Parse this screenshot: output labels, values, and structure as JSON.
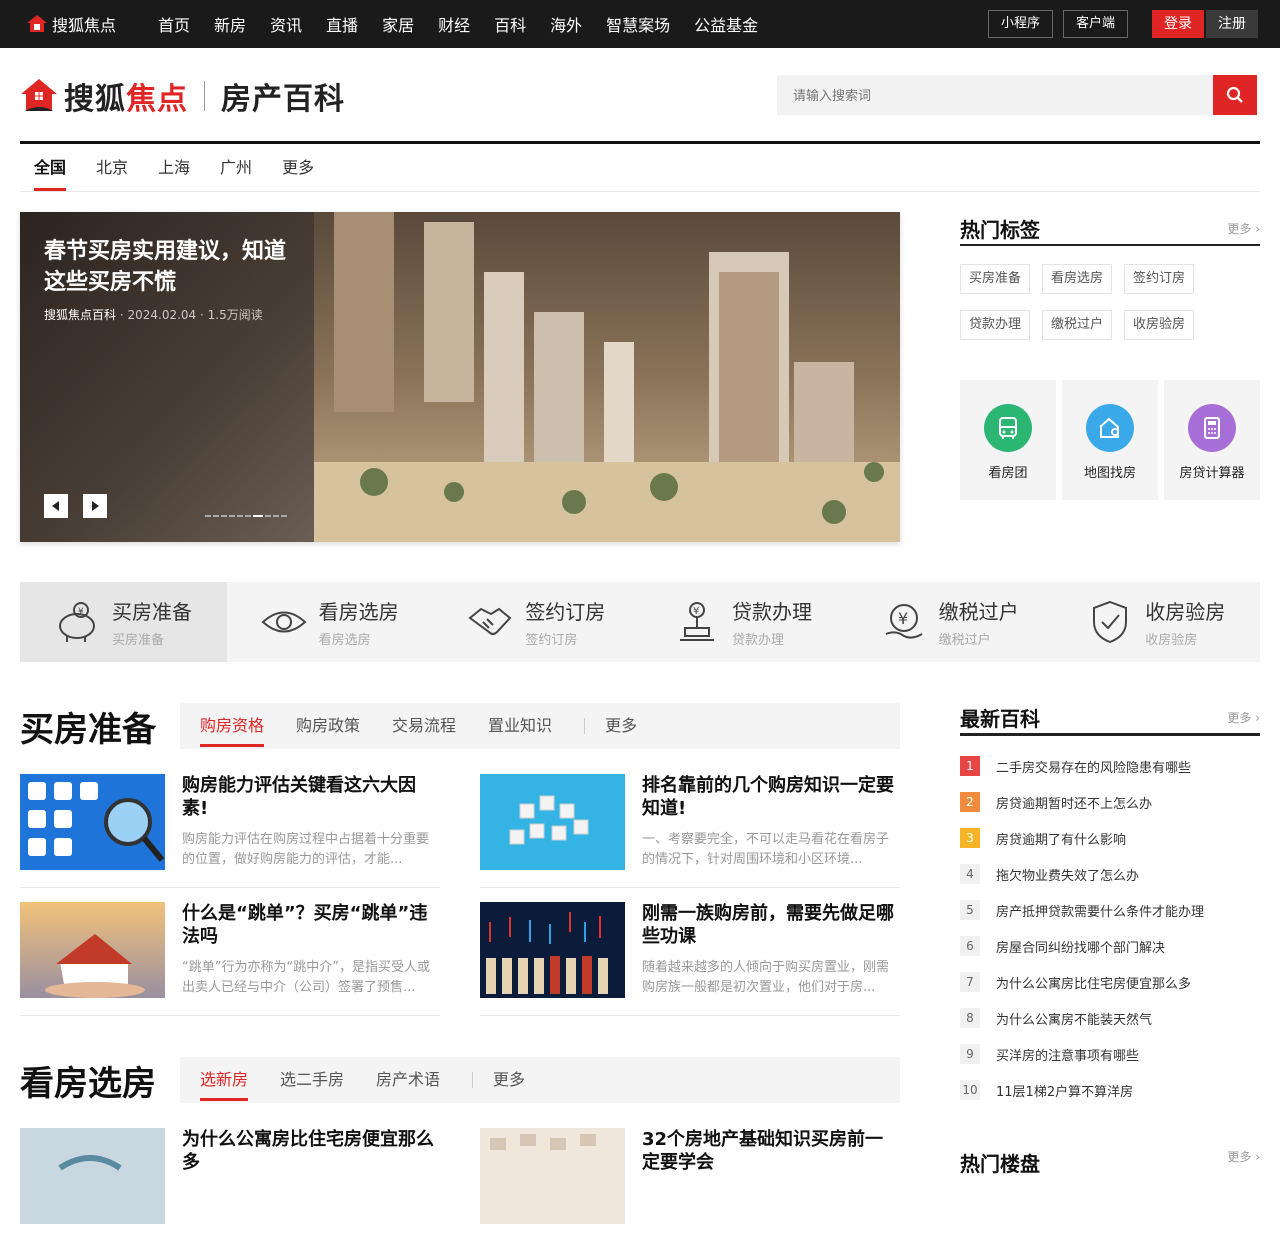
{
  "topbar": {
    "logo_text": "搜狐焦点",
    "nav": [
      "首页",
      "新房",
      "资讯",
      "直播",
      "家居",
      "财经",
      "百科",
      "海外",
      "智慧案场",
      "公益基金"
    ],
    "mini_program": "小程序",
    "client": "客户端",
    "login": "登录",
    "register": "注册"
  },
  "header": {
    "brand_left": "搜狐",
    "brand_red": "焦点",
    "section_title": "房产百科",
    "search_placeholder": "请输入搜索词"
  },
  "city_tabs": [
    "全国",
    "北京",
    "上海",
    "广州",
    "更多"
  ],
  "hero": {
    "title": "春节买房实用建议，知道这些买房不慌",
    "source": "搜狐焦点百科",
    "date": "2024.02.04",
    "reads": "1.5万阅读"
  },
  "hot_tags": {
    "title": "热门标签",
    "more": "更多",
    "tags": [
      "买房准备",
      "看房选房",
      "签约订房",
      "贷款办理",
      "缴税过户",
      "收房验房"
    ]
  },
  "tools": [
    {
      "label": "看房团",
      "icon": "bus-icon",
      "color": "#2bb673"
    },
    {
      "label": "地图找房",
      "icon": "map-house-icon",
      "color": "#3aa9ea"
    },
    {
      "label": "房贷计算器",
      "icon": "calculator-icon",
      "color": "#a86ed8"
    }
  ],
  "categories": [
    {
      "title": "买房准备",
      "sub": "买房准备",
      "icon": "piggy-bank-icon"
    },
    {
      "title": "看房选房",
      "sub": "看房选房",
      "icon": "eye-icon"
    },
    {
      "title": "签约订房",
      "sub": "签约订房",
      "icon": "handshake-icon"
    },
    {
      "title": "贷款办理",
      "sub": "贷款办理",
      "icon": "stamp-icon"
    },
    {
      "title": "缴税过户",
      "sub": "缴税过户",
      "icon": "yuan-hand-icon"
    },
    {
      "title": "收房验房",
      "sub": "收房验房",
      "icon": "shield-check-icon"
    }
  ],
  "section1": {
    "title": "买房准备",
    "tabs": [
      "购房资格",
      "购房政策",
      "交易流程",
      "置业知识"
    ],
    "more": "更多",
    "cards": [
      {
        "title": "购房能力评估关键看这六大因素!",
        "desc": "购房能力评估在购房过程中占据着十分重要的位置，做好购房能力的评估，才能..."
      },
      {
        "title": "排名靠前的几个购房知识一定要知道!",
        "desc": "一、考察要完全，不可以走马看花在看房子的情况下，针对周围环境和小区环境..."
      },
      {
        "title": "什么是“跳单”？买房“跳单”违法吗",
        "desc": "“跳单”行为亦称为“跳中介”，是指买受人或出卖人已经与中介（公司）签署了预售..."
      },
      {
        "title": "刚需一族购房前，需要先做足哪些功课",
        "desc": "随着越来越多的人倾向于购买房置业，刚需购房族一般都是初次置业，他们对于房..."
      }
    ]
  },
  "section2": {
    "title": "看房选房",
    "tabs": [
      "选新房",
      "选二手房",
      "房产术语"
    ],
    "more": "更多",
    "cards": [
      {
        "title": "为什么公寓房比住宅房便宜那么多"
      },
      {
        "title": "32个房地产基础知识买房前一定要学会"
      }
    ]
  },
  "latest": {
    "title": "最新百科",
    "more": "更多",
    "items": [
      {
        "n": "1",
        "t": "二手房交易存在的风险隐患有哪些"
      },
      {
        "n": "2",
        "t": "房贷逾期暂时还不上怎么办"
      },
      {
        "n": "3",
        "t": "房贷逾期了有什么影响"
      },
      {
        "n": "4",
        "t": "拖欠物业费失效了怎么办"
      },
      {
        "n": "5",
        "t": "房产抵押贷款需要什么条件才能办理"
      },
      {
        "n": "6",
        "t": "房屋合同纠纷找哪个部门解决"
      },
      {
        "n": "7",
        "t": "为什么公寓房比住宅房便宜那么多"
      },
      {
        "n": "8",
        "t": "为什么公寓房不能装天然气"
      },
      {
        "n": "9",
        "t": "买洋房的注意事项有哪些"
      },
      {
        "n": "10",
        "t": "11层1梯2户算不算洋房"
      }
    ]
  },
  "hot_building": {
    "title": "热门楼盘",
    "more": "更多"
  },
  "colors": {
    "accent": "#e02525",
    "rank1": "#e84545",
    "rank2": "#f08a3c",
    "rank3": "#f5b526"
  }
}
